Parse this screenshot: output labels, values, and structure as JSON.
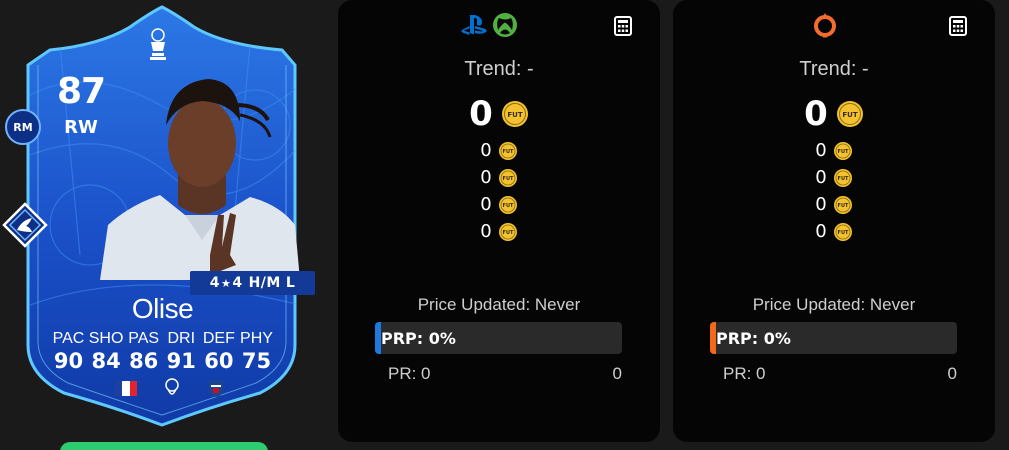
{
  "card": {
    "rating": "87",
    "position": "RW",
    "alt_position": "RM",
    "skills_left": "4",
    "skills_right": "4",
    "work_rates": "H/M",
    "preferred_foot": "L",
    "name": "Olise",
    "stats": [
      {
        "label": "PAC",
        "value": "90"
      },
      {
        "label": "SHO",
        "value": "84"
      },
      {
        "label": "PAS",
        "value": "86"
      },
      {
        "label": "DRI",
        "value": "91"
      },
      {
        "label": "DEF",
        "value": "60"
      },
      {
        "label": "PHY",
        "value": "75"
      }
    ],
    "nation_icon": "france-flag-icon",
    "league_icon": "premier-league-icon",
    "club_icon": "crystal-palace-badge-icon",
    "playstyle_icon": "playstyle-plus-icon",
    "card_color": "#1d4fd0",
    "border_color": "#5ec8ff"
  },
  "panels": [
    {
      "platforms": [
        "playstation-icon",
        "xbox-icon"
      ],
      "calculator_icon": "calculator-icon",
      "trend_label": "Trend:",
      "trend_value": "-",
      "main_price": "0",
      "sub_prices": [
        "0",
        "0",
        "0",
        "0"
      ],
      "coin_label": "FUT",
      "updated_label": "Price Updated:",
      "updated_value": "Never",
      "prp_label": "PRP: 0%",
      "prp_accent": "#1f7ae0",
      "pr_label": "PR: 0",
      "pr_value": "0"
    },
    {
      "platforms": [
        "origin-pc-icon"
      ],
      "calculator_icon": "calculator-icon",
      "trend_label": "Trend:",
      "trend_value": "-",
      "main_price": "0",
      "sub_prices": [
        "0",
        "0",
        "0",
        "0"
      ],
      "coin_label": "FUT",
      "updated_label": "Price Updated:",
      "updated_value": "Never",
      "prp_label": "PRP: 0%",
      "prp_accent": "#f06a1a",
      "pr_label": "PR: 0",
      "pr_value": "0"
    }
  ],
  "colors": {
    "background": "#1a1a1a",
    "panel": "#050505",
    "coin_gold": "#f2c230",
    "green_button": "#2ecc71",
    "playstation_blue": "#0070d1",
    "xbox_green": "#52b043",
    "origin_orange": "#f56c2d"
  }
}
